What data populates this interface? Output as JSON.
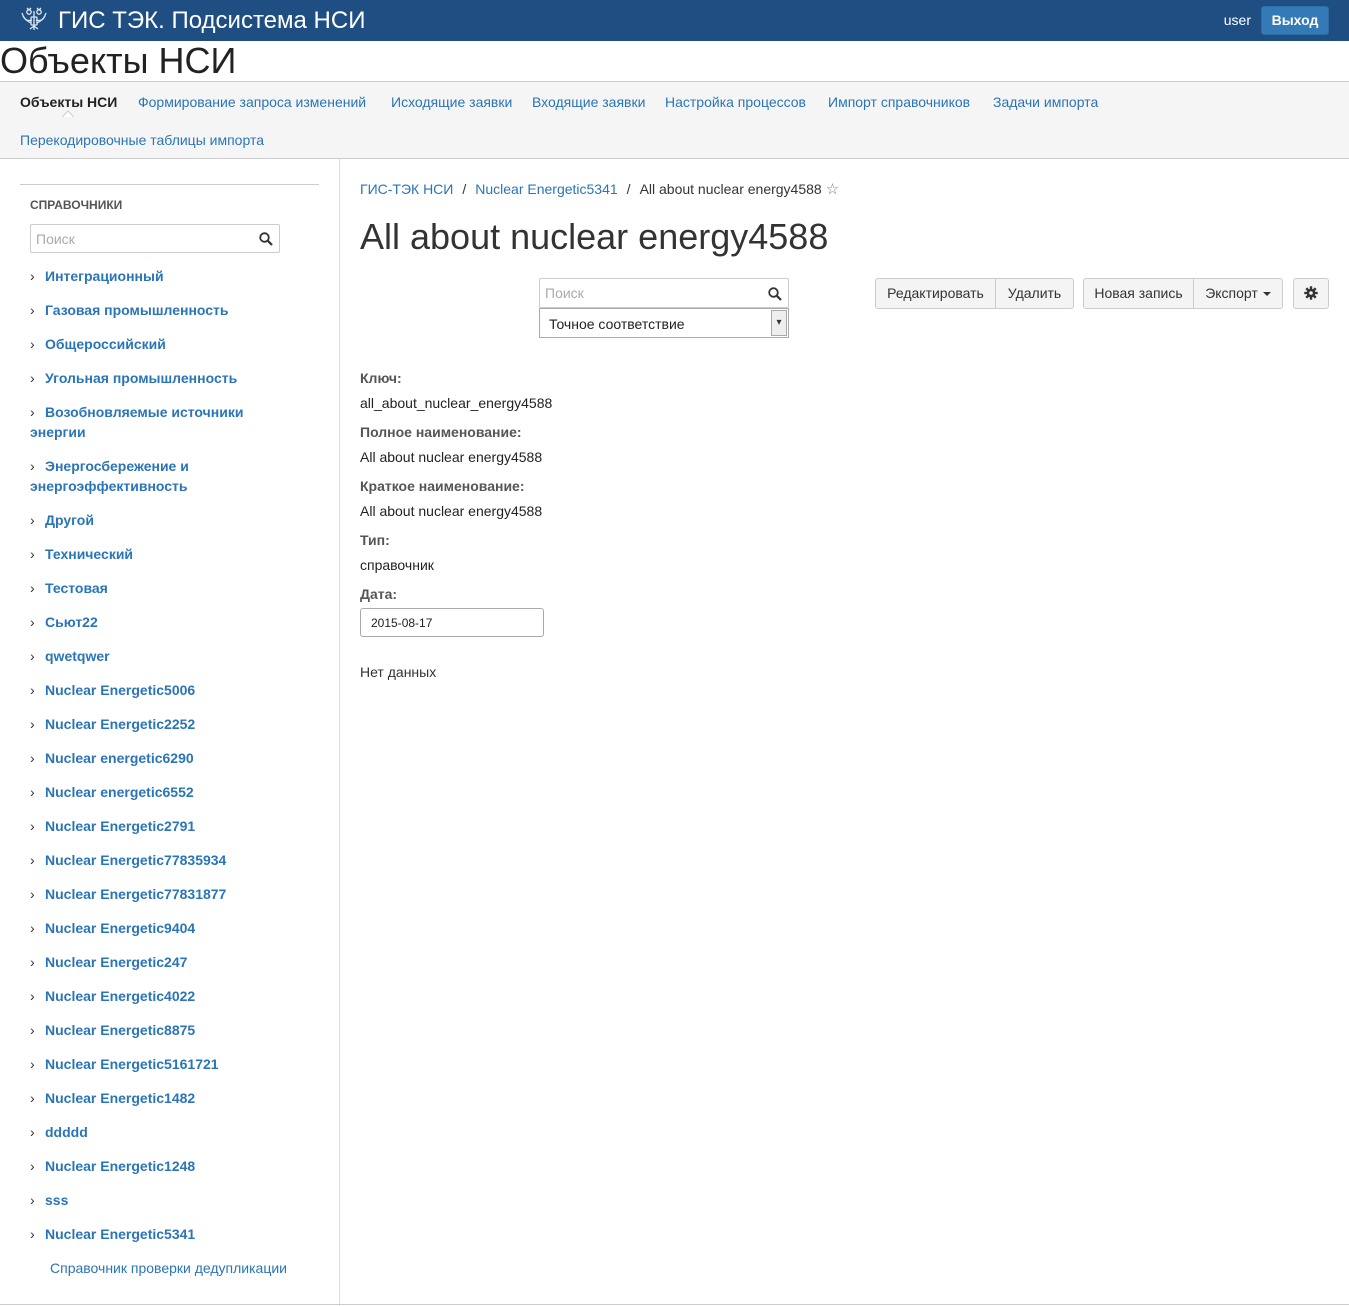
{
  "topbar": {
    "app_title": "ГИС ТЭК. Подсистема НСИ",
    "username": "user",
    "logout_label": "Выход"
  },
  "page": {
    "title": "Объекты НСИ"
  },
  "nav": {
    "items": [
      "Объекты НСИ",
      "Формирование запроса изменений",
      "Исходящие заявки",
      "Входящие заявки",
      "Настройка процессов",
      "Импорт справочников",
      "Задачи импорта",
      "Перекодировочные таблицы импорта"
    ],
    "active": "Объекты НСИ"
  },
  "sidebar": {
    "section_title": "СПРАВОЧНИКИ",
    "search_placeholder": "Поиск",
    "items": [
      "Интеграционный",
      "Газовая промышленность",
      "Общероссийский",
      "Угольная промышленность",
      "Возобновляемые источники энергии",
      "Энергосбережение и энергоэффективность",
      "Другой",
      "Технический",
      "Тестовая",
      "Сьют22",
      "qwetqwer",
      "Nuclear Energetic5006",
      "Nuclear Energetic2252",
      "Nuclear energetic6290",
      "Nuclear energetic6552",
      "Nuclear Energetic2791",
      "Nuclear Energetic77835934",
      "Nuclear Energetic77831877",
      "Nuclear Energetic9404",
      "Nuclear Energetic247",
      "Nuclear Energetic4022",
      "Nuclear Energetic8875",
      "Nuclear Energetic5161721",
      "Nuclear Energetic1482",
      "ddddd",
      "Nuclear Energetic1248",
      "sss",
      "Nuclear Energetic5341"
    ],
    "plain_item": "Справочник проверки дедупликации"
  },
  "main": {
    "breadcrumb": {
      "root": "ГИС-ТЭК НСИ",
      "parent": "Nuclear Energetic5341",
      "current": "All about nuclear energy4588"
    },
    "title": "All about nuclear energy4588",
    "search_placeholder": "Поиск",
    "match_mode": "Точное соответствие",
    "buttons": {
      "edit": "Редактировать",
      "delete": "Удалить",
      "new_record": "Новая запись",
      "export": "Экспорт"
    },
    "fields": {
      "key_label": "Ключ:",
      "key_value": "all_about_nuclear_energy4588",
      "full_name_label": "Полное наименование:",
      "full_name_value": "All about nuclear energy4588",
      "short_name_label": "Краткое наименование:",
      "short_name_value": "All about nuclear energy4588",
      "type_label": "Тип:",
      "type_value": "справочник",
      "date_label": "Дата:",
      "date_value": "2015-08-17"
    },
    "no_data": "Нет данных"
  },
  "colors": {
    "topbar": "#1f4e83",
    "link": "#2a75b8",
    "logout_button": "#337ab7"
  }
}
